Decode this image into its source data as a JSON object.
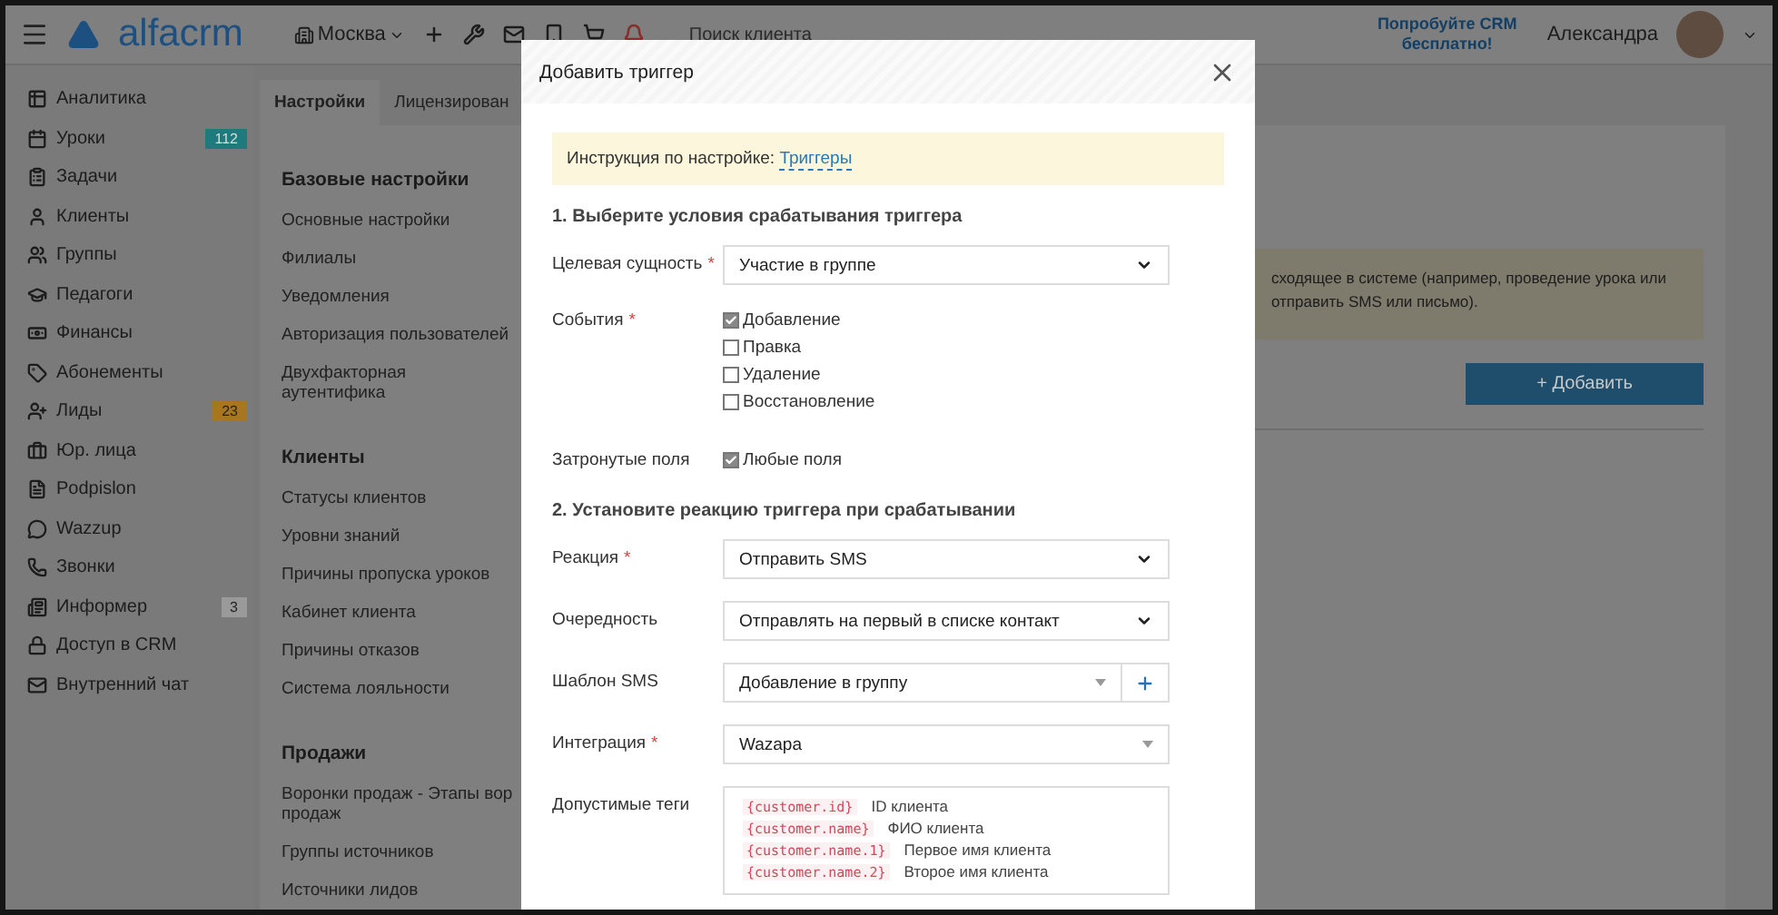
{
  "topbar": {
    "logo": "alfacrm",
    "branch": "Москва",
    "search": {
      "placeholder": "Поиск клиента"
    },
    "promo": "Попробуйте CRM бесплатно!",
    "user": "Александра"
  },
  "sidebar": {
    "items": [
      {
        "label": "Аналитика"
      },
      {
        "label": "Уроки",
        "badge": "112",
        "color": "#1f7a7e"
      },
      {
        "label": "Задачи"
      },
      {
        "label": "Клиенты"
      },
      {
        "label": "Группы"
      },
      {
        "label": "Педагоги"
      },
      {
        "label": "Финансы"
      },
      {
        "label": "Абонементы"
      },
      {
        "label": "Лиды",
        "badge": "23",
        "color": "#a8761e"
      },
      {
        "label": "Юр. лица"
      },
      {
        "label": "Podpislon"
      },
      {
        "label": "Wazzup"
      },
      {
        "label": "Звонки"
      },
      {
        "label": "Информер",
        "badge": "3",
        "color": "#9a9a9a"
      },
      {
        "label": "Доступ в CRM"
      },
      {
        "label": "Внутренний чат"
      }
    ]
  },
  "tabs": [
    {
      "label": "Настройки",
      "selected": true
    },
    {
      "label": "Лицензирован",
      "selected": false
    }
  ],
  "settings_nav": [
    {
      "heading": "Базовые настройки",
      "items": [
        "Основные настройки",
        "Филиалы",
        "Уведомления",
        "Авторизация пользователей",
        "Двухфакторная аутентифика"
      ]
    },
    {
      "heading": "Клиенты",
      "items": [
        "Статусы клиентов",
        "Уровни знаний",
        "Причины пропуска уроков",
        "Кабинет клиента",
        "Причины отказов",
        "Система лояльности"
      ]
    },
    {
      "heading": "Продажи",
      "items": [
        "Воронки продаж - Этапы вор\nпродаж",
        "Группы источников",
        "Источники лидов"
      ]
    }
  ],
  "note": [
    "сходящее в системе (например, проведение урока или",
    "отправить SMS или письмо)."
  ],
  "add_button": "+ Добавить",
  "modal": {
    "title": "Добавить триггер",
    "required_mark": "*",
    "info": {
      "text": "Инструкция по настройке: ",
      "link": "Триггеры"
    },
    "sections": [
      {
        "title": "1. Выберите условия срабатывания триггера",
        "fields": [
          {
            "kind": "select",
            "label": "Целевая сущность",
            "required": true,
            "value": "Участие в группе"
          },
          {
            "kind": "checkboxes",
            "label": "События",
            "required": true,
            "options": [
              {
                "label": "Добавление",
                "checked": true
              },
              {
                "label": "Правка",
                "checked": false
              },
              {
                "label": "Удаление",
                "checked": false
              },
              {
                "label": "Восстановление",
                "checked": false
              }
            ]
          },
          {
            "kind": "checkboxes",
            "label": "Затронутые поля",
            "required": false,
            "options": [
              {
                "label": "Любые поля",
                "checked": true
              }
            ]
          }
        ]
      },
      {
        "title": "2. Установите реакцию триггера при срабатывании",
        "fields": [
          {
            "kind": "select",
            "label": "Реакция",
            "required": true,
            "value": "Отправить SMS"
          },
          {
            "kind": "select",
            "label": "Очередность",
            "required": false,
            "value": "Отправлять на первый в списке контакт"
          },
          {
            "kind": "combo_add",
            "label": "Шаблон SMS",
            "required": false,
            "value": "Добавление в группу"
          },
          {
            "kind": "combo",
            "label": "Интеграция",
            "required": true,
            "value": "Wazapa"
          },
          {
            "kind": "tags",
            "label": "Допустимые теги",
            "required": false,
            "tags": [
              {
                "code": "{customer.id}",
                "text": "ID клиента"
              },
              {
                "code": "{customer.name}",
                "text": "ФИО клиента"
              },
              {
                "code": "{customer.name.1}",
                "text": "Первое имя клиента"
              },
              {
                "code": "{customer.name.2}",
                "text": "Второе имя клиента"
              }
            ]
          }
        ]
      }
    ]
  }
}
